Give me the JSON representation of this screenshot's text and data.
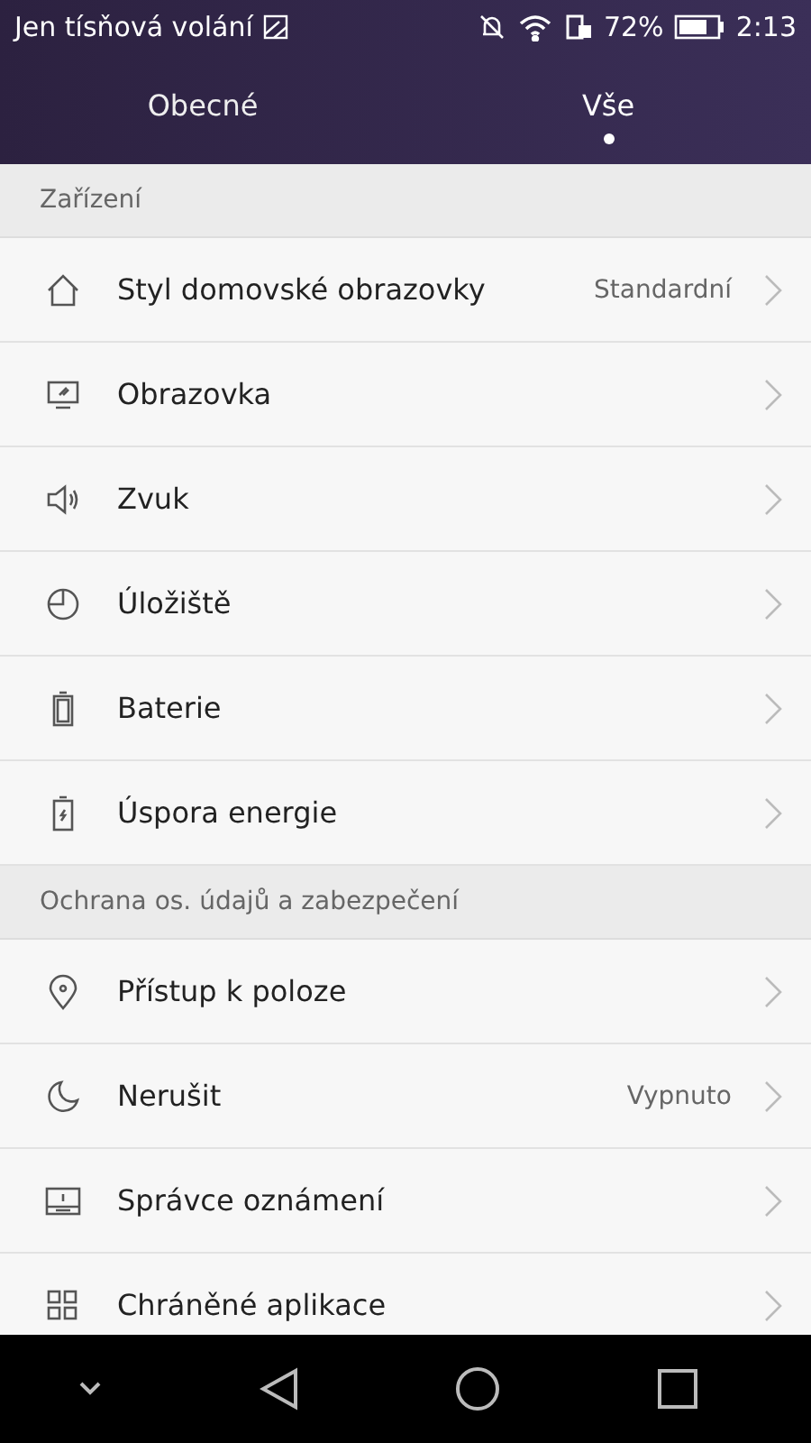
{
  "status_bar": {
    "carrier": "Jen tísňová volání",
    "battery_percent": "72%",
    "time": "2:13"
  },
  "tabs": [
    {
      "label": "Obecné",
      "selected": false
    },
    {
      "label": "Vše",
      "selected": true
    }
  ],
  "sections": [
    {
      "title": "Zařízení",
      "items": [
        {
          "label": "Styl domovské obrazovky",
          "value": "Standardní"
        },
        {
          "label": "Obrazovka"
        },
        {
          "label": "Zvuk"
        },
        {
          "label": "Úložiště"
        },
        {
          "label": "Baterie"
        },
        {
          "label": "Úspora energie"
        }
      ]
    },
    {
      "title": "Ochrana os. údajů a zabezpečení",
      "items": [
        {
          "label": "Přístup k poloze"
        },
        {
          "label": "Nerušit",
          "value": "Vypnuto"
        },
        {
          "label": "Správce oznámení"
        },
        {
          "label": "Chráněné aplikace"
        }
      ]
    }
  ]
}
